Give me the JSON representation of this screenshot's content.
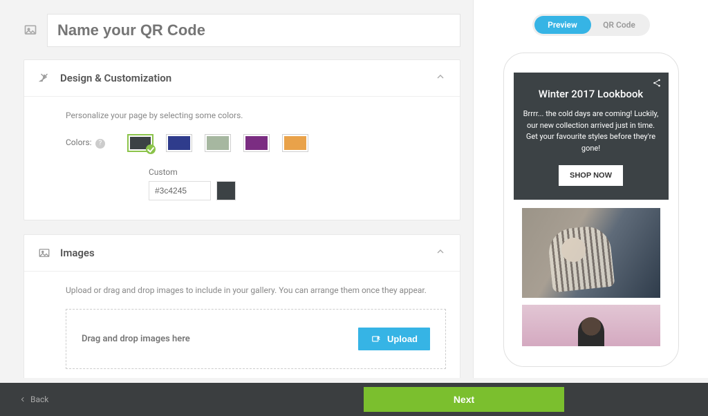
{
  "name_input": {
    "placeholder": "Name your QR Code"
  },
  "design_panel": {
    "title": "Design & Customization",
    "desc": "Personalize your page by selecting some colors.",
    "colors_label": "Colors:",
    "swatches": [
      "#3c4245",
      "#2f3c8c",
      "#a6b7a0",
      "#7b2d82",
      "#e9a24a"
    ],
    "selected_index": 0,
    "custom_label": "Custom",
    "hex_value": "#3c4245"
  },
  "images_panel": {
    "title": "Images",
    "desc": "Upload or drag and drop images to include in your gallery. You can arrange them once they appear.",
    "drop_text": "Drag and drop images here",
    "upload_label": "Upload"
  },
  "preview_toggle": {
    "options": [
      "Preview",
      "QR Code"
    ],
    "active_index": 0
  },
  "preview": {
    "title": "Winter 2017 Lookbook",
    "para": "Brrrr... the cold days are coming! Luckily, our new collection arrived just in time. Get your favourite styles before they're gone!",
    "button": "SHOP NOW"
  },
  "footer": {
    "back": "Back",
    "next": "Next"
  }
}
